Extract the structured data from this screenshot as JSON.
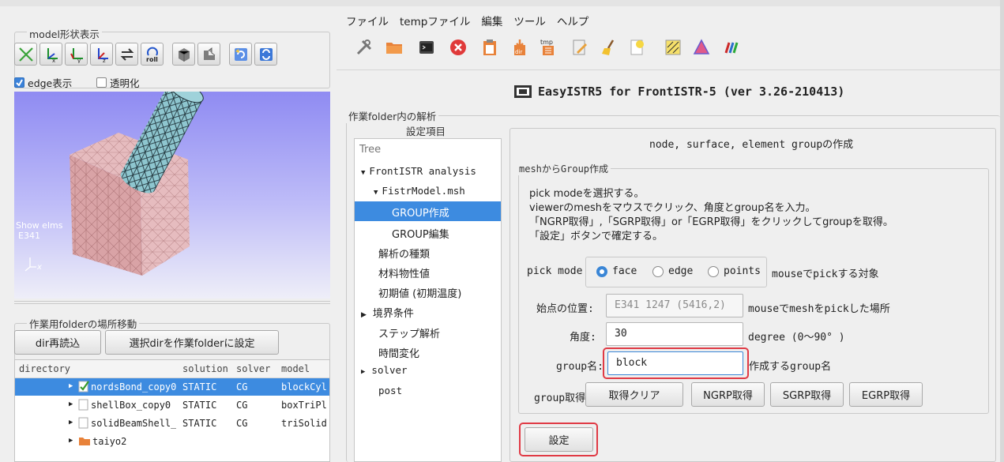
{
  "left": {
    "model_view": {
      "legend": "model形状表示",
      "view_buttons": [
        "x-axis-view",
        "y-axis-view",
        "y-axis-view-alt",
        "z-axis-view",
        "swap-view",
        "roll-view",
        "solid-view",
        "wire-view",
        "reload-view",
        "refresh-view"
      ],
      "roll_label": "roll",
      "edge_label": "edge表示",
      "edge_checked": true,
      "transparent_label": "透明化",
      "transparent_checked": false
    },
    "viewer": {
      "overlay_line1": "Show elms",
      "overlay_line2": "E341",
      "axis_label": "x"
    },
    "folder_nav": {
      "legend": "作業用folderの場所移動",
      "reload_label": "dir再読込",
      "set_dir_label": "選択dirを作業folderに設定"
    },
    "dir_table": {
      "headers": [
        "directory",
        "solution",
        "solver",
        "model"
      ],
      "rows": [
        {
          "name": "nordsBond_copy0",
          "solution": "STATIC",
          "solver": "CG",
          "model": "blockCyl",
          "selected": true,
          "checked": true
        },
        {
          "name": "shellBox_copy0",
          "solution": "STATIC",
          "solver": "CG",
          "model": "boxTriPl",
          "selected": false,
          "checked": false
        },
        {
          "name": "solidBeamShell_",
          "solution": "STATIC",
          "solver": "CG",
          "model": "triSolid",
          "selected": false,
          "checked": false
        },
        {
          "name": "taiyo2",
          "solution": "",
          "solver": "",
          "model": "",
          "selected": false,
          "folder": true
        }
      ]
    }
  },
  "menu": [
    "ファイル",
    "tempファイル",
    "編集",
    "ツール",
    "ヘルプ"
  ],
  "toolbar_icons": [
    "tools-icon",
    "folder-icon",
    "terminal-icon",
    "close-icon",
    "paste-icon",
    "dir-icon",
    "tmp-icon",
    "edit-icon",
    "broom-icon",
    "note-icon",
    "mesh-icon",
    "shape-icon",
    "color-icon"
  ],
  "toolbar_text": {
    "dir": "dir",
    "tmp": "tmp"
  },
  "app_title": "EasyISTR5 for FrontISTR-5 (ver 3.26-210413)",
  "work": {
    "legend": "作業folder内の解析",
    "settings_label": "設定項目",
    "tree_header": "Tree",
    "tree": [
      {
        "label": "FrontISTR analysis",
        "arrow": "▼",
        "mono": true
      },
      {
        "label": "FistrModel.msh",
        "arrow": "▼",
        "mono": true
      },
      {
        "label": "GROUP作成",
        "arrow": "",
        "selected": true
      },
      {
        "label": "GROUP編集",
        "arrow": ""
      },
      {
        "label": "解析の種類",
        "arrow": ""
      },
      {
        "label": "材料物性値",
        "arrow": ""
      },
      {
        "label": "初期値 (初期温度)",
        "arrow": ""
      },
      {
        "label": "境界条件",
        "arrow": "▶"
      },
      {
        "label": "ステップ解析",
        "arrow": ""
      },
      {
        "label": "時間変化",
        "arrow": ""
      },
      {
        "label": "solver",
        "arrow": "▶",
        "mono": true
      },
      {
        "label": "post",
        "arrow": "",
        "mono": true
      }
    ]
  },
  "panel": {
    "title": "node, surface, element groupの作成",
    "group_legend": "meshからGroup作成",
    "instructions": [
      "pick modeを選択する。",
      "viewerのmeshをマウスでクリック、角度とgroup名を入力。",
      "「NGRP取得」,「SGRP取得」or「EGRP取得」をクリックしてgroupを取得。",
      "「設定」ボタンで確定する。"
    ],
    "pick_mode_label": "pick mode",
    "pick_options": [
      "face",
      "edge",
      "points"
    ],
    "pick_selected": "face",
    "pick_hint": "mouseでpickする対象",
    "start_label": "始点の位置:",
    "start_value": "E341 1247 (5416,2)",
    "start_hint": "mouseでmeshをpickした場所",
    "angle_label": "角度:",
    "angle_value": "30",
    "angle_hint": "degree (0〜90° )",
    "group_name_label": "group名:",
    "group_name_value": "block",
    "group_name_hint": "作成するgroup名",
    "get_label": "group取得",
    "buttons": [
      "取得クリア",
      "NGRP取得",
      "SGRP取得",
      "EGRP取得"
    ],
    "set_label": "設定"
  },
  "colors": {
    "selection": "#3d8be0",
    "highlight": "#e03a45",
    "radio": "#3a86d6"
  }
}
